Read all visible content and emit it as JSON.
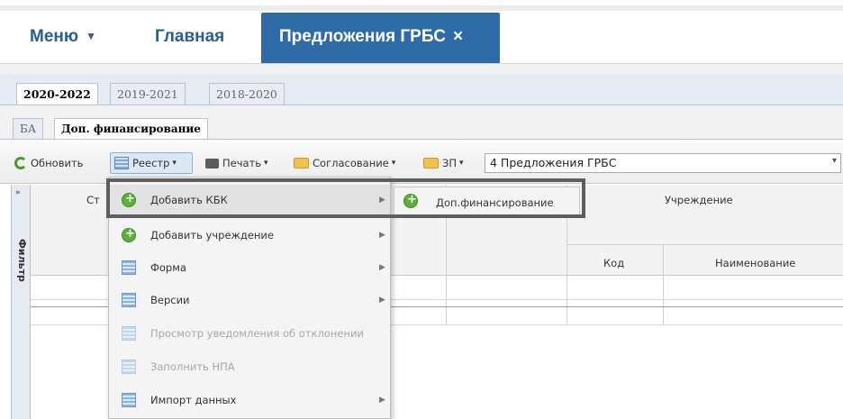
{
  "nav": {
    "menu_label": "Меню",
    "menu_caret": "▼",
    "home_label": "Главная",
    "active_tab_label": "Предложения ГРБС",
    "active_tab_close": "×"
  },
  "year_tabs": [
    {
      "label": "2020-2022",
      "active": true
    },
    {
      "label": "2019-2021",
      "active": false
    },
    {
      "label": "2018-2020",
      "active": false
    }
  ],
  "sub_tabs": [
    {
      "label": "БА",
      "active": false
    },
    {
      "label": "Доп. финансирование",
      "active": true
    }
  ],
  "toolbar": {
    "refresh_label": "Обновить",
    "reestr_label": "Реестр",
    "print_label": "Печать",
    "approval_label": "Согласование",
    "zp_label": "ЗП",
    "dropdown_marker": "▾",
    "select_value": "4 Предложения ГРБС",
    "select_arrow": "▾"
  },
  "filter_strip": {
    "expand_label": "»",
    "label": "Фильтр"
  },
  "grid": {
    "col_first_partial": "Ст",
    "group_header": "Учреждение",
    "col_code": "Код",
    "col_name": "Наименование"
  },
  "menu": {
    "items": [
      {
        "label": "Добавить КБК",
        "icon": "plus-circle-icon",
        "submenu": true,
        "disabled": false
      },
      {
        "label": "Добавить учреждение",
        "icon": "plus-circle-icon",
        "submenu": true,
        "disabled": false
      },
      {
        "label": "Форма",
        "icon": "form-icon",
        "submenu": true,
        "disabled": false
      },
      {
        "label": "Версии",
        "icon": "form-icon",
        "submenu": true,
        "disabled": false
      },
      {
        "label": "Просмотр уведомления об отклонении",
        "icon": "form-icon",
        "submenu": false,
        "disabled": true
      },
      {
        "label": "Заполнить НПА",
        "icon": "form-icon",
        "submenu": false,
        "disabled": true
      },
      {
        "label": "Импорт данных",
        "icon": "form-icon",
        "submenu": true,
        "disabled": false
      }
    ],
    "submenu_arrow": "▶"
  },
  "submenu": {
    "label": "Доп.финансирование",
    "icon": "plus-circle-icon"
  },
  "colors": {
    "nav_text": "#2a5d97",
    "active_tab_bg": "#2e6ba7",
    "highlight_border": "#5e5e5e",
    "plus_icon": "#5db03c"
  }
}
